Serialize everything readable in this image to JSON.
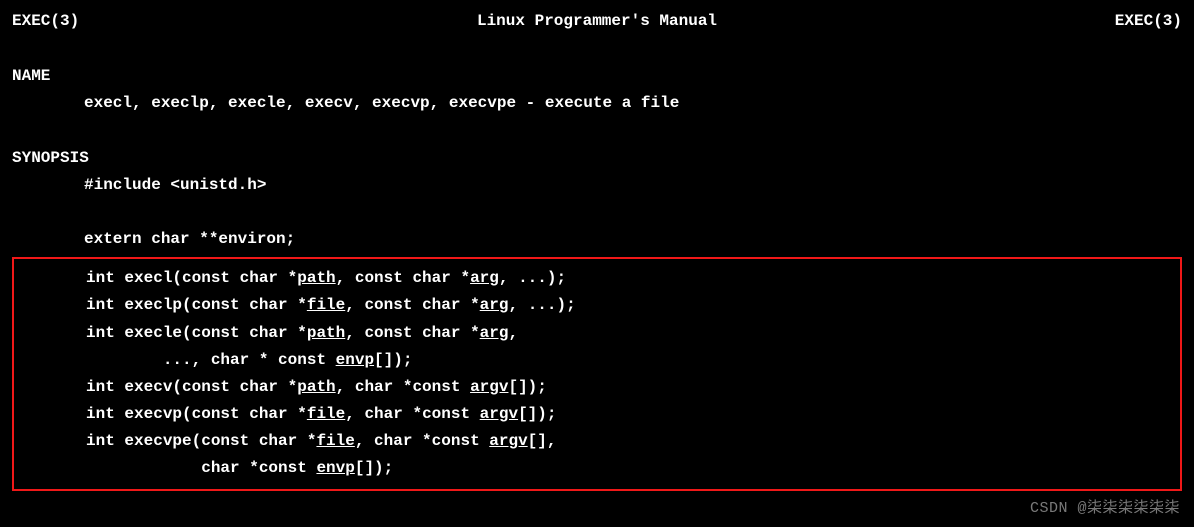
{
  "header": {
    "left": "EXEC(3)",
    "center": "Linux Programmer's Manual",
    "right": "EXEC(3)"
  },
  "name": {
    "heading": "NAME",
    "line": "execl, execlp, execle, execv, execvp, execvpe - execute a file"
  },
  "synopsis": {
    "heading": "SYNOPSIS",
    "include": "#include <unistd.h>",
    "extern": "extern char **environ;",
    "funcs": {
      "execl": {
        "pre": "int execl(const char *",
        "u1": "path",
        "mid1": ", const char *",
        "u2": "arg",
        "post": ", ...);"
      },
      "execlp": {
        "pre": "int execlp(const char *",
        "u1": "file",
        "mid1": ", const char *",
        "u2": "arg",
        "post": ", ...);"
      },
      "execle1": {
        "pre": "int execle(const char *",
        "u1": "path",
        "mid1": ", const char *",
        "u2": "arg",
        "post": ","
      },
      "execle2": {
        "pre": "        ..., char * const ",
        "u1": "envp",
        "post": "[]);"
      },
      "execv": {
        "pre": "int execv(const char *",
        "u1": "path",
        "mid1": ", char *const ",
        "u2": "argv",
        "post": "[]);"
      },
      "execvp": {
        "pre": "int execvp(const char *",
        "u1": "file",
        "mid1": ", char *const ",
        "u2": "argv",
        "post": "[]);"
      },
      "execvpe1": {
        "pre": "int execvpe(const char *",
        "u1": "file",
        "mid1": ", char *const ",
        "u2": "argv",
        "post": "[],"
      },
      "execvpe2": {
        "pre": "            char *const ",
        "u1": "envp",
        "post": "[]);"
      }
    }
  },
  "watermark": "CSDN @柒柒柒柒柒柒"
}
